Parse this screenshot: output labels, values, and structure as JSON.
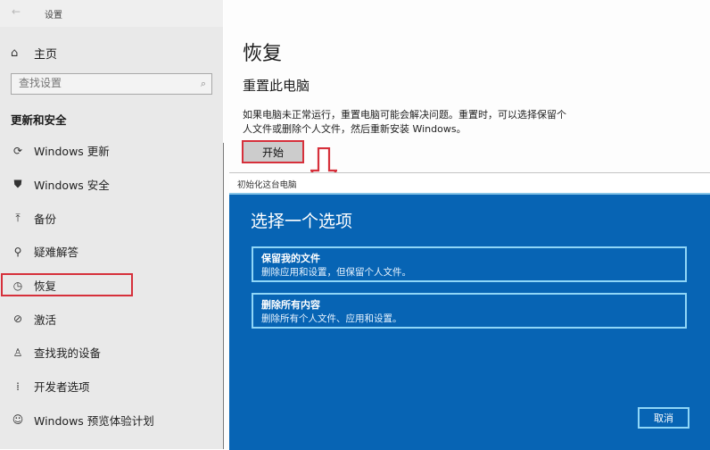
{
  "window": {
    "back_icon": "←",
    "title": "设置"
  },
  "sidebar": {
    "home": {
      "icon": "⌂",
      "label": "主页"
    },
    "search": {
      "placeholder": "查找设置",
      "icon": "⌕"
    },
    "section_title": "更新和安全",
    "items": [
      {
        "icon": "⟳",
        "label": "Windows 更新",
        "name": "windows-update"
      },
      {
        "icon": "⛊",
        "label": "Windows 安全",
        "name": "windows-security"
      },
      {
        "icon": "⤒",
        "label": "备份",
        "name": "backup"
      },
      {
        "icon": "⚲",
        "label": "疑难解答",
        "name": "troubleshoot"
      },
      {
        "icon": "◷",
        "label": "恢复",
        "name": "recovery",
        "selected": true
      },
      {
        "icon": "⊘",
        "label": "激活",
        "name": "activation"
      },
      {
        "icon": "♙",
        "label": "查找我的设备",
        "name": "find-my-device"
      },
      {
        "icon": "⁞",
        "label": "开发者选项",
        "name": "developer-options"
      },
      {
        "icon": "☺",
        "label": "Windows 预览体验计划",
        "name": "insider-program"
      }
    ]
  },
  "main": {
    "title": "恢复",
    "subtitle": "重置此电脑",
    "description": "如果电脑未正常运行，重置电脑可能会解决问题。重置时，可以选择保留个人文件或删除个人文件，然后重新安装 Windows。",
    "start_button": "开始"
  },
  "dialog": {
    "title": "初始化这台电脑",
    "heading": "选择一个选项",
    "options": [
      {
        "title": "保留我的文件",
        "desc": "删除应用和设置，但保留个人文件。"
      },
      {
        "title": "删除所有内容",
        "desc": "删除所有个人文件、应用和设置。"
      }
    ],
    "cancel_button": "取消"
  },
  "colors": {
    "highlight": "#d6303b",
    "dialog_bg": "#0764b4",
    "option_border": "#8fd6f7"
  }
}
